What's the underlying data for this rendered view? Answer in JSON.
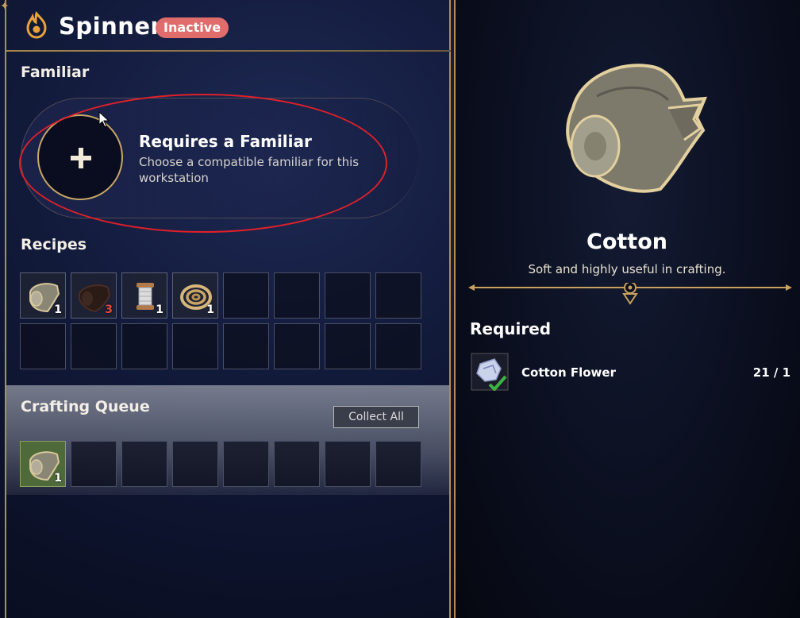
{
  "header": {
    "title": "Spinner",
    "status_badge": "Inactive"
  },
  "familiar": {
    "section_label": "Familiar",
    "title": "Requires a Familiar",
    "description": "Choose a compatible familiar for this workstation"
  },
  "recipes": {
    "section_label": "Recipes",
    "slots": [
      {
        "item": "cotton-cloth-icon",
        "qty": "1",
        "qty_color": "#ffffff"
      },
      {
        "item": "dark-cloth-icon",
        "qty": "3",
        "qty_color": "#e8483c"
      },
      {
        "item": "thread-spool-icon",
        "qty": "1",
        "qty_color": "#ffffff"
      },
      {
        "item": "rope-coil-icon",
        "qty": "1",
        "qty_color": "#ffffff"
      }
    ]
  },
  "queue": {
    "section_label": "Crafting Queue",
    "collect_label": "Collect All",
    "slots": [
      {
        "item": "cotton-cloth-icon",
        "qty": "1"
      }
    ]
  },
  "detail": {
    "item_name": "Cotton",
    "item_description": "Soft and highly useful in crafting.",
    "required_label": "Required",
    "requirements": [
      {
        "name": "Cotton Flower",
        "count": "21 / 1",
        "icon": "cotton-flower-icon"
      }
    ]
  },
  "colors": {
    "accent_gold": "#c8a765",
    "badge_red": "#e06c6c",
    "highlight_red": "#e0202a"
  }
}
